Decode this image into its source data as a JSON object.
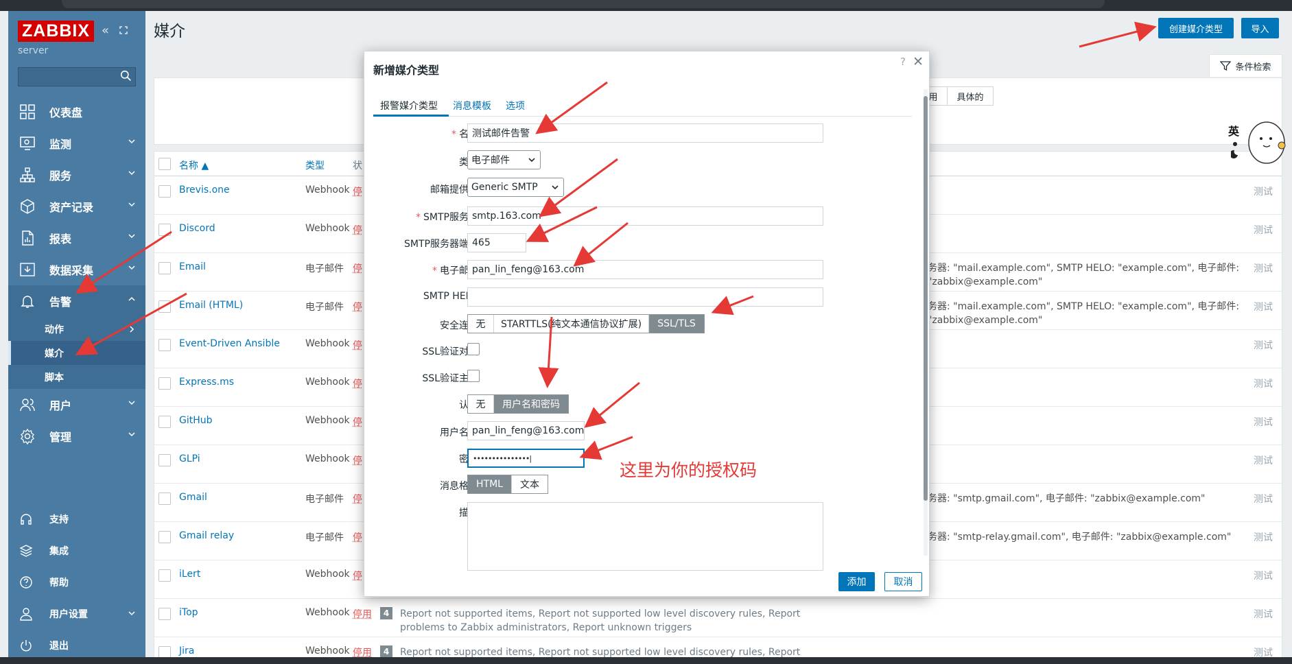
{
  "app": {
    "logo": "ZABBIX",
    "server": "server",
    "page_title": "媒介",
    "help": "?",
    "create_button": "创建媒介类型",
    "import_button": "导入",
    "filter_tab": "条件检索",
    "filter_seg1": "用",
    "filter_seg2": "具体的"
  },
  "sidebar": {
    "items": [
      {
        "label": "仪表盘",
        "icon": "dashboard-icon"
      },
      {
        "label": "监测",
        "icon": "monitoring-icon"
      },
      {
        "label": "服务",
        "icon": "services-icon"
      },
      {
        "label": "资产记录",
        "icon": "inventory-icon"
      },
      {
        "label": "报表",
        "icon": "reports-icon"
      },
      {
        "label": "数据采集",
        "icon": "data-collection-icon"
      },
      {
        "label": "告警",
        "icon": "bell-icon"
      }
    ],
    "alerts_sub": [
      {
        "label": "动作"
      },
      {
        "label": "媒介"
      },
      {
        "label": "脚本"
      }
    ],
    "after": [
      {
        "label": "用户",
        "icon": "users-icon"
      },
      {
        "label": "管理",
        "icon": "gear-icon"
      }
    ],
    "bottom": [
      {
        "label": "支持",
        "icon": "headset-icon"
      },
      {
        "label": "集成",
        "icon": "integrations-icon"
      },
      {
        "label": "帮助",
        "icon": "help-icon"
      },
      {
        "label": "用户设置",
        "icon": "user-settings-icon"
      },
      {
        "label": "退出",
        "icon": "power-icon"
      }
    ]
  },
  "table": {
    "headers": {
      "name": "名称 ▲",
      "type": "类型",
      "status": "状"
    },
    "rows": [
      {
        "name": "Brevis.one",
        "type": "Webhook",
        "status": "停",
        "test": "测试",
        "detail": ""
      },
      {
        "name": "Discord",
        "type": "Webhook",
        "status": "停",
        "test": "测试",
        "detail": ""
      },
      {
        "name": "Email",
        "type": "电子邮件",
        "status": "停",
        "test": "测试",
        "detail": "务器: \"mail.example.com\", SMTP HELO: \"example.com\", 电子邮件: \"zabbix@example.com\""
      },
      {
        "name": "Email (HTML)",
        "type": "电子邮件",
        "status": "停",
        "test": "测试",
        "detail": "务器: \"mail.example.com\", SMTP HELO: \"example.com\", 电子邮件: \"zabbix@example.com\""
      },
      {
        "name": "Event-Driven Ansible",
        "type": "Webhook",
        "status": "停",
        "test": "测试",
        "detail": ""
      },
      {
        "name": "Express.ms",
        "type": "Webhook",
        "status": "停",
        "test": "测试",
        "detail": ""
      },
      {
        "name": "GitHub",
        "type": "Webhook",
        "status": "停",
        "test": "测试",
        "detail": ""
      },
      {
        "name": "GLPi",
        "type": "Webhook",
        "status": "停",
        "test": "测试",
        "detail": ""
      },
      {
        "name": "Gmail",
        "type": "电子邮件",
        "status": "停",
        "test": "测试",
        "detail": "务器: \"smtp.gmail.com\", 电子邮件: \"zabbix@example.com\""
      },
      {
        "name": "Gmail relay",
        "type": "电子邮件",
        "status": "停",
        "test": "测试",
        "detail": "务器: \"smtp-relay.gmail.com\", 电子邮件: \"zabbix@example.com\""
      },
      {
        "name": "iLert",
        "type": "Webhook",
        "status": "停",
        "test": "测试",
        "detail": ""
      },
      {
        "name": "iTop",
        "type": "Webhook",
        "status": "停用",
        "test": "测试",
        "count": "4",
        "actions": [
          "Report not supported items",
          "Report not supported low level discovery rules",
          "Report problems to Zabbix administrators",
          "Report unknown triggers"
        ]
      },
      {
        "name": "Jira",
        "type": "Webhook",
        "status": "停用",
        "test": "测试",
        "count": "4",
        "actions": [
          "Report not supported items",
          "Report not supported low level discovery rules",
          "Report problems to Zabbix"
        ]
      }
    ]
  },
  "modal": {
    "title": "新增媒介类型",
    "help": "?",
    "close": "✕",
    "tabs": [
      "报警媒介类型",
      "消息模板",
      "选项"
    ],
    "fields": {
      "name_label": "名称",
      "name_value": "测试邮件告警",
      "type_label": "类型",
      "type_value": "电子邮件",
      "provider_label": "邮箱提供商",
      "provider_value": "Generic SMTP",
      "smtp_server_label": "SMTP服务器",
      "smtp_server_value": "smtp.163.com",
      "smtp_port_label": "SMTP服务器端口",
      "smtp_port_value": "465",
      "email_label": "电子邮件",
      "email_value": "pan_lin_feng@163.com",
      "helo_label": "SMTP HELO",
      "helo_value": "",
      "security_label": "安全连接",
      "security_options": [
        "无",
        "STARTTLS(纯文本通信协议扩展)",
        "SSL/TLS"
      ],
      "security_selected": "SSL/TLS",
      "ssl_peer_label": "SSL验证对端",
      "ssl_host_label": "SSL验证主机",
      "auth_label": "认证",
      "auth_options": [
        "无",
        "用户名和密码"
      ],
      "auth_selected": "用户名和密码",
      "username_label": "用户名称",
      "username_value": "pan_lin_feng@163.com",
      "password_label": "密码",
      "password_value": "•••••••••••••••|",
      "format_label": "消息格式",
      "format_options": [
        "HTML",
        "文本"
      ],
      "format_selected": "HTML",
      "description_label": "描述"
    },
    "add_button": "添加",
    "cancel_button": "取消"
  },
  "annotation": "这里为你的授权码",
  "ime": "英",
  "colors": {
    "sidebar": "#4a7ba3",
    "accent": "#0275b8",
    "disabled": "#e45959",
    "arrow": "#e53935",
    "logo": "#d40000"
  }
}
